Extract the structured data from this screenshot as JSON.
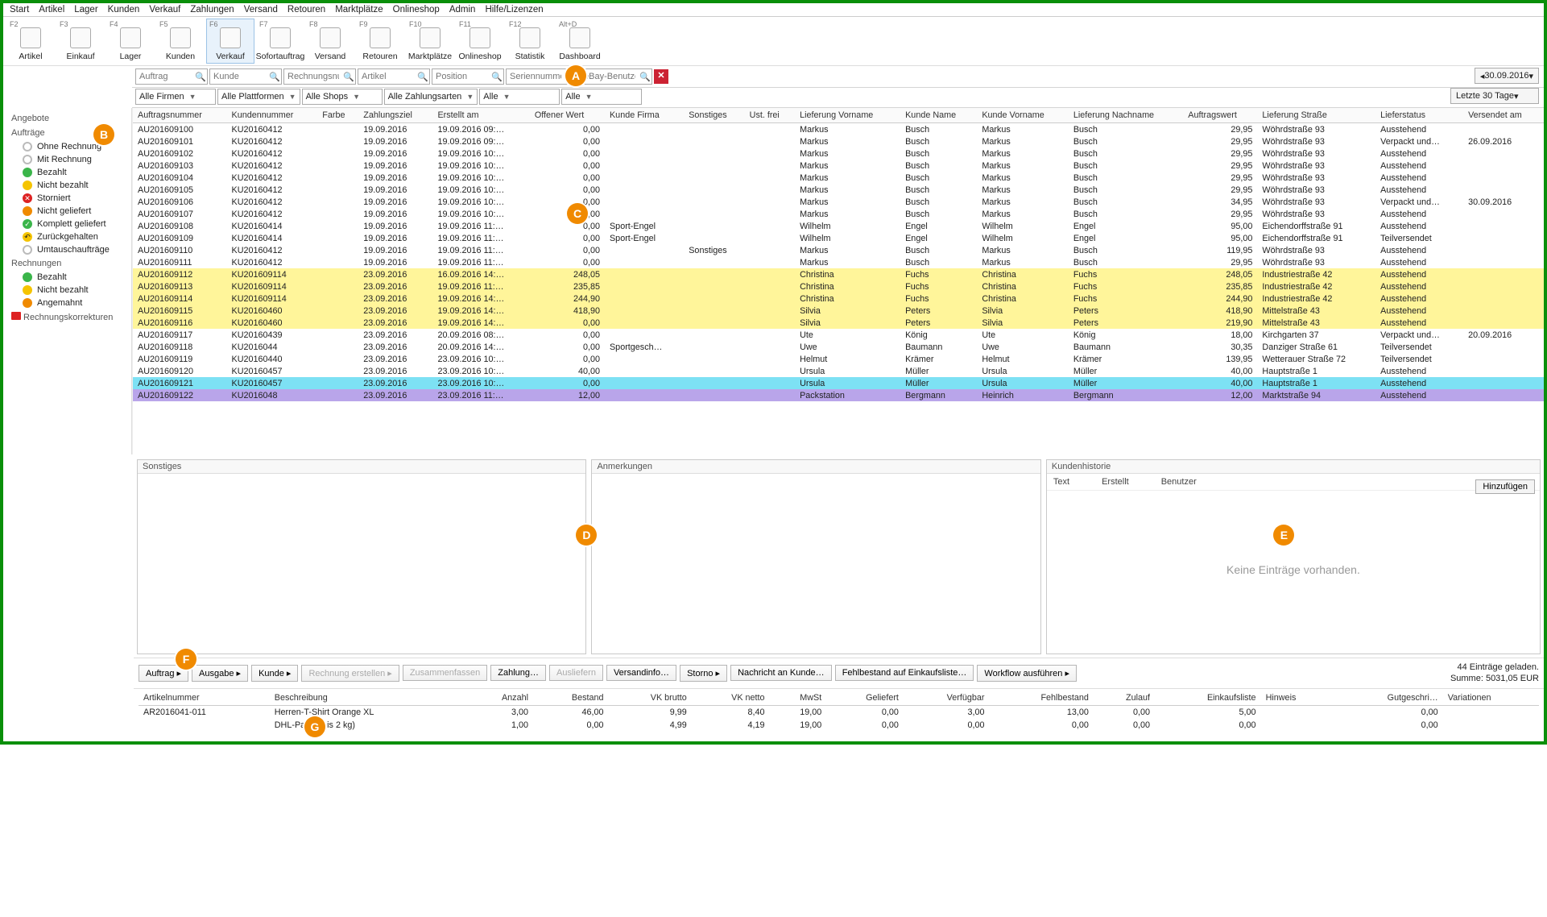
{
  "menu": [
    "Start",
    "Artikel",
    "Lager",
    "Kunden",
    "Verkauf",
    "Zahlungen",
    "Versand",
    "Retouren",
    "Marktplätze",
    "Onlineshop",
    "Admin",
    "Hilfe/Lizenzen"
  ],
  "ribbon": [
    {
      "key": "F2",
      "label": "Artikel"
    },
    {
      "key": "F3",
      "label": "Einkauf"
    },
    {
      "key": "F4",
      "label": "Lager"
    },
    {
      "key": "F5",
      "label": "Kunden"
    },
    {
      "key": "F6",
      "label": "Verkauf",
      "active": true
    },
    {
      "key": "F7",
      "label": "Sofortauftrag"
    },
    {
      "key": "F8",
      "label": "Versand"
    },
    {
      "key": "F9",
      "label": "Retouren"
    },
    {
      "key": "F10",
      "label": "Marktplätze"
    },
    {
      "key": "F11",
      "label": "Onlineshop"
    },
    {
      "key": "F12",
      "label": "Statistik"
    },
    {
      "key": "Alt+D",
      "label": "Dashboard"
    }
  ],
  "filters": {
    "searches": [
      {
        "ph": "Auftrag"
      },
      {
        "ph": "Kunde"
      },
      {
        "ph": "Rechnungsnummer"
      },
      {
        "ph": "Artikel"
      },
      {
        "ph": "Position"
      },
      {
        "ph": "Seriennummer"
      },
      {
        "ph": "eBay-Benutzer"
      }
    ],
    "dropdowns": [
      "Alle Firmen",
      "Alle Plattformen",
      "Alle Shops",
      "Alle Zahlungsarten",
      "Alle",
      "Alle"
    ],
    "date": "30.09.2016",
    "range": "Letzte 30 Tage"
  },
  "sidebar": {
    "groups": [
      {
        "title": "Angebote",
        "items": []
      },
      {
        "title": "Aufträge",
        "items": [
          {
            "label": "Ohne Rechnung",
            "cls": "b-gray"
          },
          {
            "label": "Mit Rechnung",
            "cls": "b-gray"
          },
          {
            "label": "Bezahlt",
            "cls": "b-green"
          },
          {
            "label": "Nicht bezahlt",
            "cls": "b-yellow"
          },
          {
            "label": "Storniert",
            "cls": "b-redx",
            "tx": "✕"
          },
          {
            "label": "Nicht geliefert",
            "cls": "b-orange"
          },
          {
            "label": "Komplett geliefert",
            "cls": "b-check",
            "tx": "✓"
          },
          {
            "label": "Zurückgehalten",
            "cls": "b-back",
            "tx": "↶"
          },
          {
            "label": "Umtauschaufträge",
            "cls": "b-gray"
          }
        ]
      },
      {
        "title": "Rechnungen",
        "items": [
          {
            "label": "Bezahlt",
            "cls": "b-green"
          },
          {
            "label": "Nicht bezahlt",
            "cls": "b-yellow"
          },
          {
            "label": "Angemahnt",
            "cls": "b-orange"
          }
        ]
      },
      {
        "title": "Rechnungskorrekturen",
        "items": [],
        "icon": "b-redsq"
      }
    ]
  },
  "columns": [
    "Auftragsnummer",
    "Kundennummer",
    "Farbe",
    "Zahlungsziel",
    "Erstellt am",
    "Offener Wert",
    "Kunde Firma",
    "Sonstiges",
    "Ust. frei",
    "Lieferung Vorname",
    "Kunde Name",
    "Kunde Vorname",
    "Lieferung Nachname",
    "Auftragswert",
    "Lieferung Straße",
    "Lieferstatus",
    "Versendet am"
  ],
  "rows": [
    {
      "c": [
        "AU201609100",
        "KU20160412",
        "",
        "19.09.2016",
        "19.09.2016 09:…",
        "0,00",
        "",
        "",
        "",
        "Markus",
        "Busch",
        "Markus",
        "Busch",
        "29,95",
        "Wöhrdstraße 93",
        "Ausstehend",
        ""
      ]
    },
    {
      "c": [
        "AU201609101",
        "KU20160412",
        "",
        "19.09.2016",
        "19.09.2016 09:…",
        "0,00",
        "",
        "",
        "",
        "Markus",
        "Busch",
        "Markus",
        "Busch",
        "29,95",
        "Wöhrdstraße 93",
        "Verpackt und…",
        "26.09.2016"
      ]
    },
    {
      "c": [
        "AU201609102",
        "KU20160412",
        "",
        "19.09.2016",
        "19.09.2016 10:…",
        "0,00",
        "",
        "",
        "",
        "Markus",
        "Busch",
        "Markus",
        "Busch",
        "29,95",
        "Wöhrdstraße 93",
        "Ausstehend",
        ""
      ]
    },
    {
      "c": [
        "AU201609103",
        "KU20160412",
        "",
        "19.09.2016",
        "19.09.2016 10:…",
        "0,00",
        "",
        "",
        "",
        "Markus",
        "Busch",
        "Markus",
        "Busch",
        "29,95",
        "Wöhrdstraße 93",
        "Ausstehend",
        ""
      ]
    },
    {
      "c": [
        "AU201609104",
        "KU20160412",
        "",
        "19.09.2016",
        "19.09.2016 10:…",
        "0,00",
        "",
        "",
        "",
        "Markus",
        "Busch",
        "Markus",
        "Busch",
        "29,95",
        "Wöhrdstraße 93",
        "Ausstehend",
        ""
      ]
    },
    {
      "c": [
        "AU201609105",
        "KU20160412",
        "",
        "19.09.2016",
        "19.09.2016 10:…",
        "0,00",
        "",
        "",
        "",
        "Markus",
        "Busch",
        "Markus",
        "Busch",
        "29,95",
        "Wöhrdstraße 93",
        "Ausstehend",
        ""
      ]
    },
    {
      "c": [
        "AU201609106",
        "KU20160412",
        "",
        "19.09.2016",
        "19.09.2016 10:…",
        "0,00",
        "",
        "",
        "",
        "Markus",
        "Busch",
        "Markus",
        "Busch",
        "34,95",
        "Wöhrdstraße 93",
        "Verpackt und…",
        "30.09.2016"
      ]
    },
    {
      "c": [
        "AU201609107",
        "KU20160412",
        "",
        "19.09.2016",
        "19.09.2016 10:…",
        "0,00",
        "",
        "",
        "",
        "Markus",
        "Busch",
        "Markus",
        "Busch",
        "29,95",
        "Wöhrdstraße 93",
        "Ausstehend",
        ""
      ]
    },
    {
      "c": [
        "AU201609108",
        "KU20160414",
        "",
        "19.09.2016",
        "19.09.2016 11:…",
        "0,00",
        "Sport-Engel",
        "",
        "",
        "Wilhelm",
        "Engel",
        "Wilhelm",
        "Engel",
        "95,00",
        "Eichendorffstraße 91",
        "Ausstehend",
        ""
      ]
    },
    {
      "c": [
        "AU201609109",
        "KU20160414",
        "",
        "19.09.2016",
        "19.09.2016 11:…",
        "0,00",
        "Sport-Engel",
        "",
        "",
        "Wilhelm",
        "Engel",
        "Wilhelm",
        "Engel",
        "95,00",
        "Eichendorffstraße 91",
        "Teilversendet",
        ""
      ]
    },
    {
      "c": [
        "AU201609110",
        "KU20160412",
        "",
        "19.09.2016",
        "19.09.2016 11:…",
        "0,00",
        "",
        "Sonstiges",
        "",
        "Markus",
        "Busch",
        "Markus",
        "Busch",
        "119,95",
        "Wöhrdstraße 93",
        "Ausstehend",
        ""
      ]
    },
    {
      "c": [
        "AU201609111",
        "KU20160412",
        "",
        "19.09.2016",
        "19.09.2016 11:…",
        "0,00",
        "",
        "",
        "",
        "Markus",
        "Busch",
        "Markus",
        "Busch",
        "29,95",
        "Wöhrdstraße 93",
        "Ausstehend",
        ""
      ]
    },
    {
      "c": [
        "AU201609112",
        "KU201609114",
        "",
        "23.09.2016",
        "16.09.2016 14:…",
        "248,05",
        "",
        "",
        "",
        "Christina",
        "Fuchs",
        "Christina",
        "Fuchs",
        "248,05",
        "Industriestraße 42",
        "Ausstehend",
        ""
      ],
      "hl": "yellow"
    },
    {
      "c": [
        "AU201609113",
        "KU201609114",
        "",
        "23.09.2016",
        "19.09.2016 11:…",
        "235,85",
        "",
        "",
        "",
        "Christina",
        "Fuchs",
        "Christina",
        "Fuchs",
        "235,85",
        "Industriestraße 42",
        "Ausstehend",
        ""
      ],
      "hl": "yellow"
    },
    {
      "c": [
        "AU201609114",
        "KU201609114",
        "",
        "23.09.2016",
        "19.09.2016 14:…",
        "244,90",
        "",
        "",
        "",
        "Christina",
        "Fuchs",
        "Christina",
        "Fuchs",
        "244,90",
        "Industriestraße 42",
        "Ausstehend",
        ""
      ],
      "hl": "yellow"
    },
    {
      "c": [
        "AU201609115",
        "KU20160460",
        "",
        "23.09.2016",
        "19.09.2016 14:…",
        "418,90",
        "",
        "",
        "",
        "Silvia",
        "Peters",
        "Silvia",
        "Peters",
        "418,90",
        "Mittelstraße 43",
        "Ausstehend",
        ""
      ],
      "hl": "yellow"
    },
    {
      "c": [
        "AU201609116",
        "KU20160460",
        "",
        "23.09.2016",
        "19.09.2016 14:…",
        "0,00",
        "",
        "",
        "",
        "Silvia",
        "Peters",
        "Silvia",
        "Peters",
        "219,90",
        "Mittelstraße 43",
        "Ausstehend",
        ""
      ],
      "hl": "yellow"
    },
    {
      "c": [
        "AU201609117",
        "KU20160439",
        "",
        "23.09.2016",
        "20.09.2016 08:…",
        "0,00",
        "",
        "",
        "",
        "Ute",
        "König",
        "Ute",
        "König",
        "18,00",
        "Kirchgarten 37",
        "Verpackt und…",
        "20.09.2016"
      ]
    },
    {
      "c": [
        "AU201609118",
        "KU2016044",
        "",
        "23.09.2016",
        "20.09.2016 14:…",
        "0,00",
        "Sportgesch…",
        "",
        "",
        "Uwe",
        "Baumann",
        "Uwe",
        "Baumann",
        "30,35",
        "Danziger Straße 61",
        "Teilversendet",
        ""
      ]
    },
    {
      "c": [
        "AU201609119",
        "KU20160440",
        "",
        "23.09.2016",
        "23.09.2016 10:…",
        "0,00",
        "",
        "",
        "",
        "Helmut",
        "Krämer",
        "Helmut",
        "Krämer",
        "139,95",
        "Wetterauer Straße 72",
        "Teilversendet",
        ""
      ]
    },
    {
      "c": [
        "AU201609120",
        "KU20160457",
        "",
        "23.09.2016",
        "23.09.2016 10:…",
        "40,00",
        "",
        "",
        "",
        "Ursula",
        "Müller",
        "Ursula",
        "Müller",
        "40,00",
        "Hauptstraße 1",
        "Ausstehend",
        ""
      ]
    },
    {
      "c": [
        "AU201609121",
        "KU20160457",
        "",
        "23.09.2016",
        "23.09.2016 10:…",
        "0,00",
        "",
        "",
        "",
        "Ursula",
        "Müller",
        "Ursula",
        "Müller",
        "40,00",
        "Hauptstraße 1",
        "Ausstehend",
        ""
      ],
      "hl": "cyan"
    },
    {
      "c": [
        "AU201609122",
        "KU2016048",
        "",
        "23.09.2016",
        "23.09.2016 11:…",
        "12,00",
        "",
        "",
        "",
        "Packstation",
        "Bergmann",
        "Heinrich",
        "Bergmann",
        "12,00",
        "Marktstraße 94",
        "Ausstehend",
        ""
      ],
      "hl": "selected"
    }
  ],
  "panels": {
    "left": "Sonstiges",
    "mid": "Anmerkungen",
    "right": "Kundenhistorie",
    "hist_cols": [
      "Text",
      "Erstellt",
      "Benutzer"
    ],
    "hist_empty": "Keine Einträge vorhanden.",
    "hist_add": "Hinzufügen"
  },
  "actions": {
    "buttons": [
      {
        "t": "Auftrag ▸"
      },
      {
        "t": "Ausgabe ▸"
      },
      {
        "t": "Kunde ▸"
      },
      {
        "t": "Rechnung erstellen ▸",
        "d": true
      },
      {
        "t": "Zusammenfassen",
        "d": true
      },
      {
        "t": "Zahlung…"
      },
      {
        "t": "Ausliefern",
        "d": true
      },
      {
        "t": "Versandinfo…"
      },
      {
        "t": "Storno ▸"
      },
      {
        "t": "Nachricht an Kunde…"
      },
      {
        "t": "Fehlbestand auf Einkaufsliste…"
      },
      {
        "t": "Workflow ausführen ▸"
      }
    ],
    "count": "44 Einträge geladen.",
    "sum": "Summe: 5031,05 EUR"
  },
  "lines": {
    "cols": [
      "Artikelnummer",
      "Beschreibung",
      "Anzahl",
      "Bestand",
      "VK brutto",
      "VK netto",
      "MwSt",
      "Geliefert",
      "Verfügbar",
      "Fehlbestand",
      "Zulauf",
      "Einkaufsliste",
      "Hinweis",
      "Gutgeschri…",
      "Variationen"
    ],
    "rows": [
      {
        "c": [
          "AR2016041-011",
          "Herren-T-Shirt Orange XL",
          "3,00",
          "46,00",
          "9,99",
          "8,40",
          "19,00",
          "0,00",
          "3,00",
          "13,00",
          "0,00",
          "5,00",
          "",
          "0,00",
          ""
        ]
      },
      {
        "c": [
          "",
          "DHL-Paket (bis 2 kg)",
          "1,00",
          "0,00",
          "4,99",
          "4,19",
          "19,00",
          "0,00",
          "0,00",
          "0,00",
          "0,00",
          "0,00",
          "",
          "0,00",
          ""
        ]
      }
    ]
  },
  "callouts": {
    "A": "A",
    "B": "B",
    "C": "C",
    "D": "D",
    "E": "E",
    "F": "F",
    "G": "G"
  }
}
